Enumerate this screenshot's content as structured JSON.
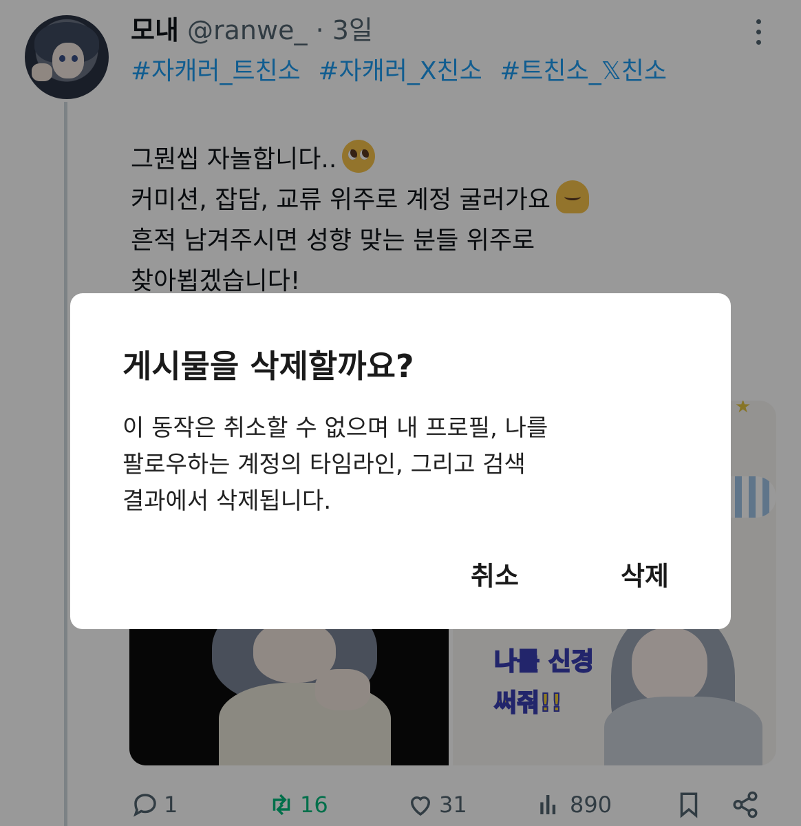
{
  "tweet": {
    "display_name": "모내",
    "handle": "@ranwe_",
    "separator": "·",
    "time": "3일",
    "hashtags": [
      "#자캐러_트친소",
      "#자캐러_X친소",
      "#트친소_𝕏친소"
    ],
    "body_lines": [
      "그뭔씹 자놀합니다..",
      "커미션, 잡담, 교류 위주로 계정 굴러가요",
      "흔적 남겨주시면 성향 맞는 분들 위주로",
      "찾아뵙겠습니다!"
    ],
    "emojis": [
      "pleading-face",
      "melting-face"
    ],
    "media_sticker_text": [
      "나를 신경",
      "써줘!!"
    ],
    "actions": {
      "replies": "1",
      "retweets": "16",
      "likes": "31",
      "views": "890"
    },
    "colors": {
      "accent": "#1d9bf0",
      "retweet": "#00ba7c",
      "muted": "#536471"
    }
  },
  "dialog": {
    "title": "게시물을 삭제할까요?",
    "message_lines": [
      "이 동작은 취소할 수 없으며 내 프로필, 나를",
      "팔로우하는 계정의 타임라인, 그리고 검색",
      "결과에서 삭제됩니다."
    ],
    "cancel_label": "취소",
    "delete_label": "삭제"
  }
}
